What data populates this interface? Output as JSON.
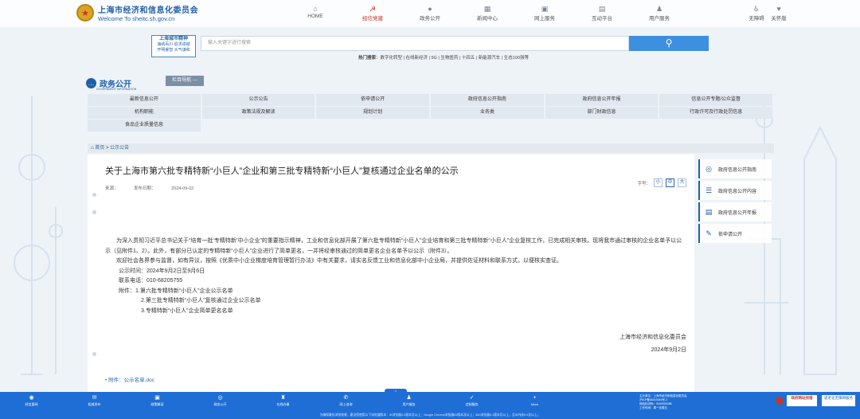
{
  "header": {
    "site_name": "上海市经济和信息化委员会",
    "site_en": "Welcome To sheitc.sh.gov.cn",
    "nav": [
      {
        "label": "HOME",
        "icon": "home-icon",
        "glyph": "⌂",
        "active": false
      },
      {
        "label": "经信党建",
        "icon": "party-icon",
        "glyph": "☭",
        "active": true
      },
      {
        "label": "政务公开",
        "icon": "chat-icon",
        "glyph": "●",
        "active": false
      },
      {
        "label": "新闻中心",
        "icon": "news-icon",
        "glyph": "▦",
        "active": false
      },
      {
        "label": "网上服务",
        "icon": "service-icon",
        "glyph": "▣",
        "active": false
      },
      {
        "label": "互动平台",
        "icon": "interact-icon",
        "glyph": "▤",
        "active": false
      },
      {
        "label": "用户服务",
        "icon": "user-icon",
        "glyph": "♟",
        "active": false
      }
    ],
    "tools": [
      {
        "label": "无障碍",
        "icon": "accessibility-icon",
        "glyph": "♿"
      },
      {
        "label": "关怀版",
        "icon": "care-icon",
        "glyph": "♥"
      }
    ]
  },
  "search": {
    "stamp_title": "上海城市精神",
    "stamp_line1": "海纳百川 追求卓越",
    "stamp_line2": "开明睿智 大气谦和",
    "placeholder": "输入关键字进行搜索",
    "hot_label": "热门搜索",
    "hot_terms": "数字化转型 | 在线新经济 | 5G | 生物医药 | 十四五 | 新能源汽车 | 生态100强等"
  },
  "gov": {
    "title": "政务公开",
    "title_en": "GOVERNMENT INFORMATION",
    "column_nav": "栏目导航 —",
    "grid": [
      [
        "最新信息公开",
        "公示公告",
        "依申请公开",
        "政府信息公开指南",
        "政府信息公开年报",
        "信息公开专题/公众监督"
      ],
      [
        "机构职能",
        "政策法规及解读",
        "规划计划",
        "业务类",
        "部门财政信息",
        "行政许可及行政处罚信息"
      ],
      [
        "食品企业质量信息"
      ]
    ]
  },
  "breadcrumb": {
    "home": "首页",
    "sep": ">",
    "current": "公示公告"
  },
  "article": {
    "title": "关于上海市第六批专精特新“小巨人”企业和第三批专精特新“小巨人”复核通过企业名单的公示",
    "font_label": "字号：",
    "font_sizes": [
      "小",
      "中",
      "大"
    ],
    "source_label": "来源：",
    "date_label": "发布日期：",
    "date": "2024-09-02",
    "para1": "为深入贯彻习近平总书记关于“培育一批‘专精特新’中小企业”的重要指示精神，工业和信息化部开展了第六批专精特新“小巨人”企业培育和第三批专精特新“小巨人”企业复核工作，已完成相关审核。现将我市通过审核的企业名单予以公示（见附件1、2）。此外，有部分已认定的专精特新“小巨人”企业进行了简单更名，一并将经审核通过的简单更名企业名单予以公示（附件3）。",
    "para2": "欢迎社会各界参与监督，如有异议，按照《优质中小企业梯度培育管理暂行办法》中有关要求，请实名反馈工业和信息化部中小企业局，并提供佐证材料和联系方式，以便核实查证。",
    "period": "公示时间：2024年9月2日至9月6日",
    "phone": "联系电话：010-68205755",
    "attach_label": "附件：1.第六批专精特新“小巨人”企业公示名单",
    "attach2": "2.第三批专精特新“小巨人”复核通过企业公示名单",
    "attach3": "3.专精特新“小巨人”企业简单更名名单",
    "signer": "上海市经济和信息化委员会",
    "sign_date": "2024年9月2日",
    "file_link": "• 附件：公示名单.doc"
  },
  "sidebar": [
    {
      "label": "政府信息公开指南",
      "icon": "compass-icon",
      "glyph": "◎"
    },
    {
      "label": "政府信息公开内容",
      "icon": "list-icon",
      "glyph": "☰"
    },
    {
      "label": "政府信息公开年报",
      "icon": "report-icon",
      "glyph": "▤"
    },
    {
      "label": "依申请公开",
      "icon": "apply-icon",
      "glyph": "✎"
    }
  ],
  "footer": {
    "items": [
      {
        "label": "经信要闻",
        "icon": "news-icon",
        "glyph": "◉"
      },
      {
        "label": "权威发布",
        "icon": "publish-icon",
        "glyph": "✉"
      },
      {
        "label": "政策解读",
        "icon": "policy-icon",
        "glyph": "▣"
      },
      {
        "label": "政务公开",
        "icon": "open-icon",
        "glyph": "◎"
      },
      {
        "label": "在线办事",
        "icon": "office-icon",
        "glyph": "♜"
      },
      {
        "label": "网上咨询",
        "icon": "consult-icon",
        "glyph": "✆"
      },
      {
        "label": "用户服务",
        "icon": "user-icon",
        "glyph": "♟"
      },
      {
        "label": "定制服务",
        "icon": "custom-icon",
        "glyph": "✓"
      },
      {
        "label": "More",
        "icon": "more-icon",
        "glyph": "+"
      }
    ],
    "info1": "主办单位：上海市经济和信息化委员会",
    "info2": "沪ICP备05019246号-2",
    "info3": "网站标识码：3100000058",
    "info4": "工作时间：周一至周五",
    "badge1": "政府网站找错",
    "badge2": "适老化无障碍服务",
    "bottom": "为确保最佳浏览效果，建议您使用以下浏览器版本：IE浏览器9.0版本及以上；Google Chrome浏览器63版本及以上；360浏览器9.1版本及以上，且IE内核9.0及以上。",
    "notch": "<"
  }
}
